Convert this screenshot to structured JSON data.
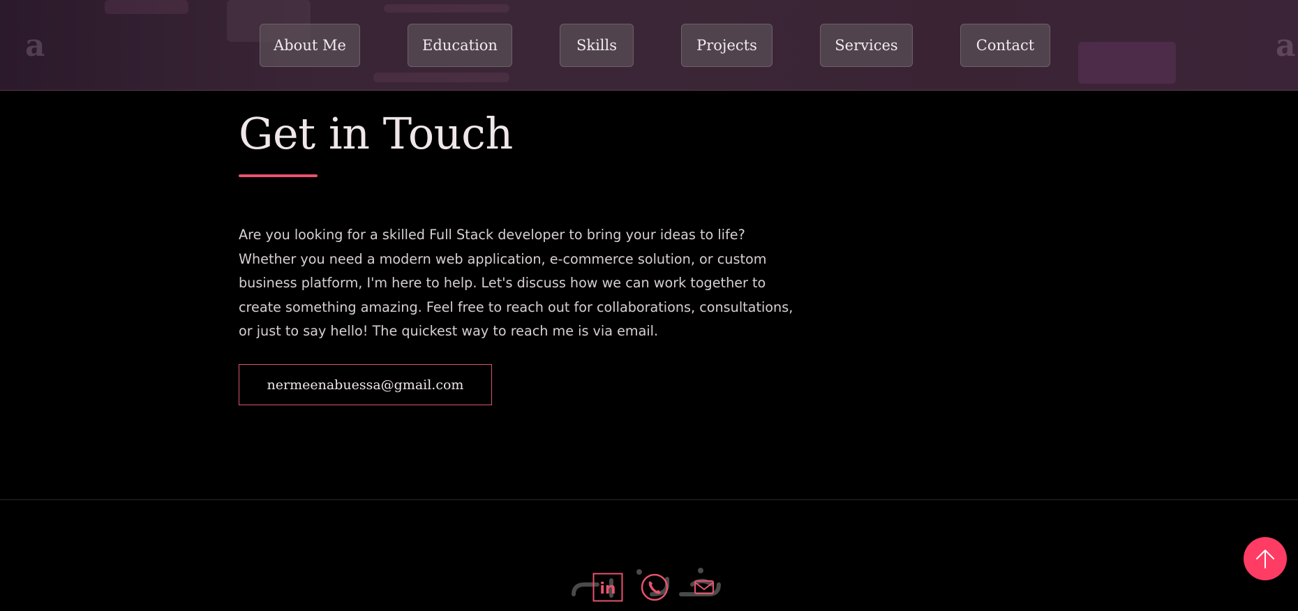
{
  "nav": {
    "items": [
      {
        "label": "About Me"
      },
      {
        "label": "Education"
      },
      {
        "label": "Skills"
      },
      {
        "label": "Projects"
      },
      {
        "label": "Services"
      },
      {
        "label": "Contact"
      }
    ]
  },
  "contact": {
    "title": "Get in Touch",
    "intro": "Are you looking for a skilled Full Stack developer to bring your ideas to life? Whether you need a modern web application, e-commerce solution, or custom business platform, I'm here to help. Let's discuss how we can work together to create something amazing. Feel free to reach out for collaborations, consultations, or just to say hello! The quickest way to reach me is via email.",
    "email": "nermeenabuessa@gmail.com"
  },
  "footer": {
    "social": [
      {
        "icon": "linkedin-icon"
      },
      {
        "icon": "phone-icon"
      },
      {
        "icon": "mail-icon"
      }
    ]
  },
  "back_to_top": {
    "icon": "arrow-up-icon"
  },
  "colors": {
    "accent": "#e8536c",
    "back_to_top": "#ff3c64",
    "background": "#000000",
    "header": "#3a2536"
  }
}
